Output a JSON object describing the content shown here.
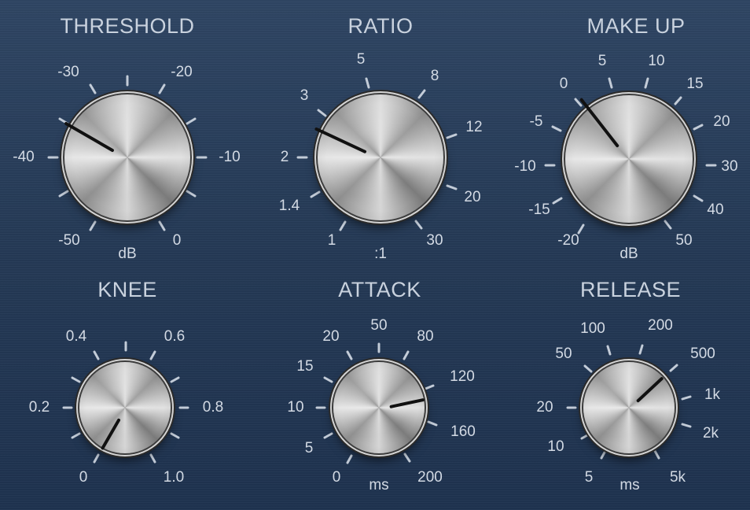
{
  "knobs": {
    "threshold": {
      "title": "THRESHOLD",
      "unit": "dB",
      "scale": [
        "-50",
        "-40",
        "-30",
        "-20",
        "-10",
        "0"
      ]
    },
    "ratio": {
      "title": "RATIO",
      "unit": ":1",
      "scale": [
        "1",
        "1.4",
        "2",
        "3",
        "5",
        "8",
        "12",
        "20",
        "30"
      ]
    },
    "makeup": {
      "title": "MAKE UP",
      "unit": "dB",
      "scale": [
        "-20",
        "-15",
        "-10",
        "-5",
        "0",
        "5",
        "10",
        "15",
        "20",
        "30",
        "40",
        "50"
      ]
    },
    "knee": {
      "title": "KNEE",
      "unit": "",
      "scale": [
        "0",
        "0.2",
        "0.4",
        "0.6",
        "0.8",
        "1.0"
      ]
    },
    "attack": {
      "title": "ATTACK",
      "unit": "ms",
      "scale": [
        "0",
        "5",
        "10",
        "15",
        "20",
        "50",
        "80",
        "120",
        "160",
        "200"
      ]
    },
    "release": {
      "title": "RELEASE",
      "unit": "ms",
      "scale": [
        "5",
        "10",
        "20",
        "50",
        "100",
        "200",
        "500",
        "1k",
        "2k",
        "5k"
      ]
    }
  }
}
